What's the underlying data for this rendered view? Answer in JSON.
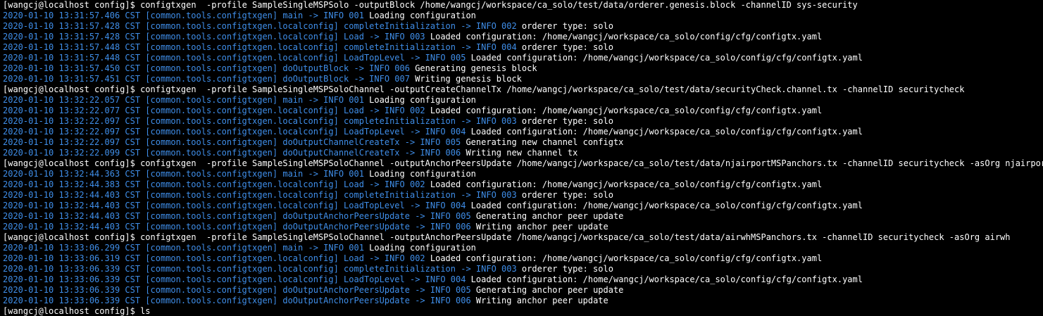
{
  "colors": {
    "background": "#000000",
    "log_prefix_blue": "#3f8ee9",
    "message_white": "#ffffff"
  },
  "terminal": {
    "lines": [
      {
        "type": "command",
        "prompt": "[wangcj@localhost config]$ ",
        "command": "configtxgen  -profile SampleSingleMSPSolo -outputBlock /home/wangcj/workspace/ca_solo/test/data/orderer.genesis.block -channelID sys-security"
      },
      {
        "type": "log",
        "prefix": "2020-01-10 13:31:57.406 CST [common.tools.configtxgen] main -> INFO 001",
        "message": " Loading configuration"
      },
      {
        "type": "log",
        "prefix": "2020-01-10 13:31:57.428 CST [common.tools.configtxgen.localconfig] completeInitialization -> INFO 002",
        "message": " orderer type: solo"
      },
      {
        "type": "log",
        "prefix": "2020-01-10 13:31:57.428 CST [common.tools.configtxgen.localconfig] Load -> INFO 003",
        "message": " Loaded configuration: /home/wangcj/workspace/ca_solo/config/cfg/configtx.yaml"
      },
      {
        "type": "log",
        "prefix": "2020-01-10 13:31:57.448 CST [common.tools.configtxgen.localconfig] completeInitialization -> INFO 004",
        "message": " orderer type: solo"
      },
      {
        "type": "log",
        "prefix": "2020-01-10 13:31:57.448 CST [common.tools.configtxgen.localconfig] LoadTopLevel -> INFO 005",
        "message": " Loaded configuration: /home/wangcj/workspace/ca_solo/config/cfg/configtx.yaml"
      },
      {
        "type": "log",
        "prefix": "2020-01-10 13:31:57.450 CST [common.tools.configtxgen] doOutputBlock -> INFO 006",
        "message": " Generating genesis block"
      },
      {
        "type": "log",
        "prefix": "2020-01-10 13:31:57.451 CST [common.tools.configtxgen] doOutputBlock -> INFO 007",
        "message": " Writing genesis block"
      },
      {
        "type": "command",
        "prompt": "[wangcj@localhost config]$ ",
        "command": "configtxgen  -profile SampleSingleMSPSoloChannel -outputCreateChannelTx /home/wangcj/workspace/ca_solo/test/data/securityCheck.channel.tx -channelID securitycheck"
      },
      {
        "type": "log",
        "prefix": "2020-01-10 13:32:22.057 CST [common.tools.configtxgen] main -> INFO 001",
        "message": " Loading configuration"
      },
      {
        "type": "log",
        "prefix": "2020-01-10 13:32:22.077 CST [common.tools.configtxgen.localconfig] Load -> INFO 002",
        "message": " Loaded configuration: /home/wangcj/workspace/ca_solo/config/cfg/configtx.yaml"
      },
      {
        "type": "log",
        "prefix": "2020-01-10 13:32:22.097 CST [common.tools.configtxgen.localconfig] completeInitialization -> INFO 003",
        "message": " orderer type: solo"
      },
      {
        "type": "log",
        "prefix": "2020-01-10 13:32:22.097 CST [common.tools.configtxgen.localconfig] LoadTopLevel -> INFO 004",
        "message": " Loaded configuration: /home/wangcj/workspace/ca_solo/config/cfg/configtx.yaml"
      },
      {
        "type": "log",
        "prefix": "2020-01-10 13:32:22.097 CST [common.tools.configtxgen] doOutputChannelCreateTx -> INFO 005",
        "message": " Generating new channel configtx"
      },
      {
        "type": "log",
        "prefix": "2020-01-10 13:32:22.099 CST [common.tools.configtxgen] doOutputChannelCreateTx -> INFO 006",
        "message": " Writing new channel tx"
      },
      {
        "type": "command",
        "prompt": "[wangcj@localhost config]$ ",
        "command": "configtxgen  -profile SampleSingleMSPSoloChannel -outputAnchorPeersUpdate /home/wangcj/workspace/ca_solo/test/data/njairportMSPanchors.tx -channelID securitycheck -asOrg njairport"
      },
      {
        "type": "log",
        "prefix": "2020-01-10 13:32:44.363 CST [common.tools.configtxgen] main -> INFO 001",
        "message": " Loading configuration"
      },
      {
        "type": "log",
        "prefix": "2020-01-10 13:32:44.383 CST [common.tools.configtxgen.localconfig] Load -> INFO 002",
        "message": " Loaded configuration: /home/wangcj/workspace/ca_solo/config/cfg/configtx.yaml"
      },
      {
        "type": "log",
        "prefix": "2020-01-10 13:32:44.403 CST [common.tools.configtxgen.localconfig] completeInitialization -> INFO 003",
        "message": " orderer type: solo"
      },
      {
        "type": "log",
        "prefix": "2020-01-10 13:32:44.403 CST [common.tools.configtxgen.localconfig] LoadTopLevel -> INFO 004",
        "message": " Loaded configuration: /home/wangcj/workspace/ca_solo/config/cfg/configtx.yaml"
      },
      {
        "type": "log",
        "prefix": "2020-01-10 13:32:44.403 CST [common.tools.configtxgen] doOutputAnchorPeersUpdate -> INFO 005",
        "message": " Generating anchor peer update"
      },
      {
        "type": "log",
        "prefix": "2020-01-10 13:32:44.403 CST [common.tools.configtxgen] doOutputAnchorPeersUpdate -> INFO 006",
        "message": " Writing anchor peer update"
      },
      {
        "type": "command",
        "prompt": "[wangcj@localhost config]$ ",
        "command": "configtxgen  -profile SampleSingleMSPSoloChannel -outputAnchorPeersUpdate /home/wangcj/workspace/ca_solo/test/data/airwhMSPanchors.tx -channelID securitycheck -asOrg airwh"
      },
      {
        "type": "log",
        "prefix": "2020-01-10 13:33:06.299 CST [common.tools.configtxgen] main -> INFO 001",
        "message": " Loading configuration"
      },
      {
        "type": "log",
        "prefix": "2020-01-10 13:33:06.319 CST [common.tools.configtxgen.localconfig] Load -> INFO 002",
        "message": " Loaded configuration: /home/wangcj/workspace/ca_solo/config/cfg/configtx.yaml"
      },
      {
        "type": "log",
        "prefix": "2020-01-10 13:33:06.339 CST [common.tools.configtxgen.localconfig] completeInitialization -> INFO 003",
        "message": " orderer type: solo"
      },
      {
        "type": "log",
        "prefix": "2020-01-10 13:33:06.339 CST [common.tools.configtxgen.localconfig] LoadTopLevel -> INFO 004",
        "message": " Loaded configuration: /home/wangcj/workspace/ca_solo/config/cfg/configtx.yaml"
      },
      {
        "type": "log",
        "prefix": "2020-01-10 13:33:06.339 CST [common.tools.configtxgen] doOutputAnchorPeersUpdate -> INFO 005",
        "message": " Generating anchor peer update"
      },
      {
        "type": "log",
        "prefix": "2020-01-10 13:33:06.339 CST [common.tools.configtxgen] doOutputAnchorPeersUpdate -> INFO 006",
        "message": " Writing anchor peer update"
      },
      {
        "type": "command",
        "prompt": "[wangcj@localhost config]$ ",
        "command": "ls"
      }
    ]
  }
}
